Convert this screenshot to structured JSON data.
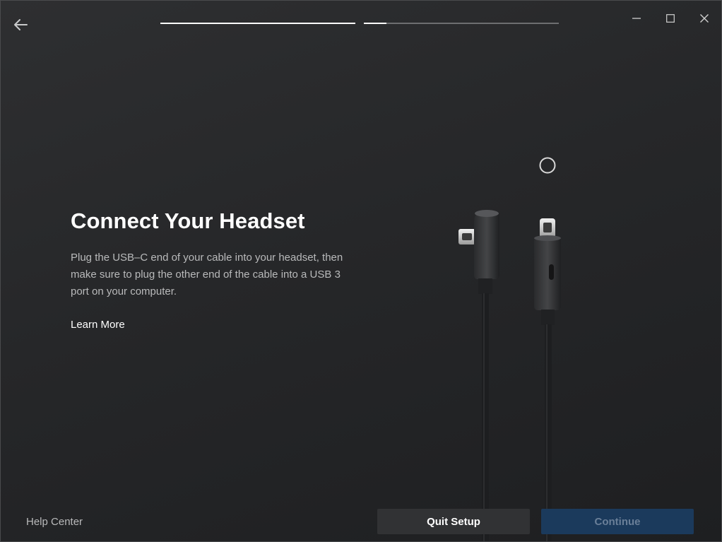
{
  "header": {
    "back_icon": "arrow-left-icon",
    "progress": [
      {
        "fill": 1.0
      },
      {
        "fill": 0.115
      }
    ],
    "window_controls": [
      "minimize-icon",
      "maximize-icon",
      "close-icon"
    ]
  },
  "main": {
    "title": "Connect Your Headset",
    "description": "Plug the USB–C end of your cable into your headset, then make sure to plug the other end of the cable into a USB 3 port on your computer.",
    "learn_more": "Learn More",
    "illustration": "usb-c-cable-illustration",
    "loading_icon": "loading-ring-icon"
  },
  "footer": {
    "help_center": "Help Center",
    "quit_setup": "Quit Setup",
    "continue": "Continue"
  },
  "colors": {
    "primary_disabled": "#1b3a5c",
    "text_muted": "#b9babb",
    "text_primary": "#ffffff"
  }
}
